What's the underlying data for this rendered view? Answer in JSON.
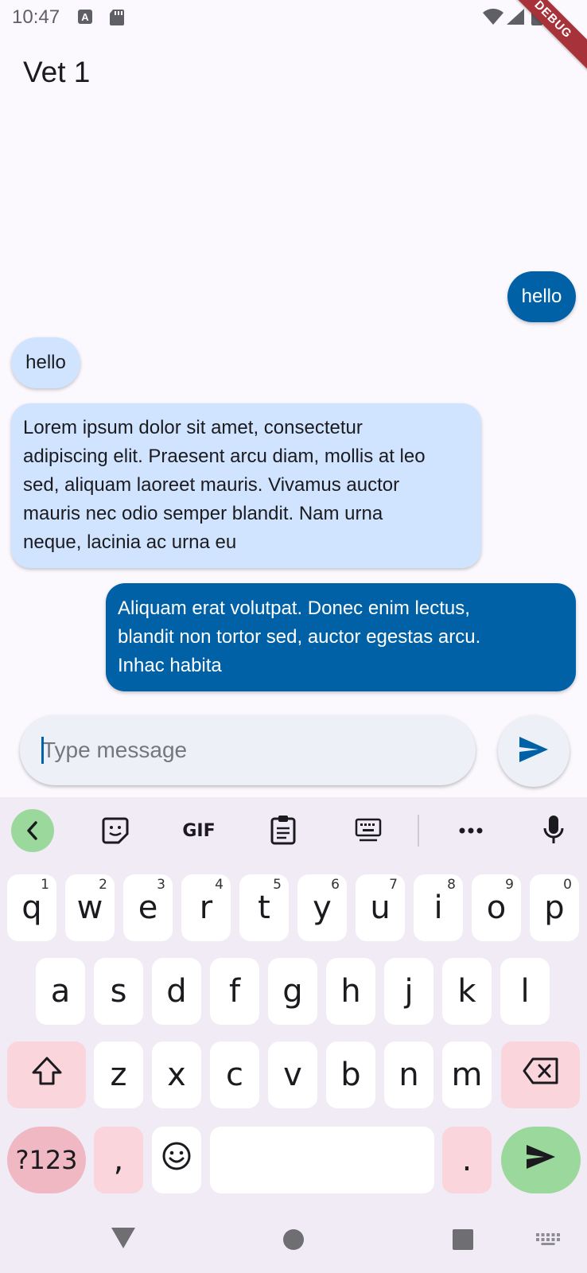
{
  "status_bar": {
    "time": "10:47",
    "debug_label": "DEBUG",
    "icons": [
      "a-notification-icon",
      "sd-card-icon",
      "wifi-icon",
      "signal-icon",
      "battery-icon"
    ]
  },
  "app_bar": {
    "title": "Vet 1"
  },
  "messages": [
    {
      "side": "sent",
      "text": "hello"
    },
    {
      "side": "received",
      "text": "hello"
    },
    {
      "side": "received",
      "text_lines": [
        "Lorem ipsum dolor sit amet, consectetur",
        "adipiscing elit. Praesent arcu diam, mollis at leo",
        "sed, aliquam laoreet mauris. Vivamus auctor",
        "mauris nec odio semper blandit. Nam urna",
        "neque, lacinia ac urna eu"
      ]
    },
    {
      "side": "sent",
      "text_lines": [
        "Aliquam erat volutpat. Donec enim lectus,",
        "blandit non tortor sed, auctor egestas arcu.",
        "Inhac habita"
      ]
    }
  ],
  "composer": {
    "placeholder": "Type message",
    "value": "",
    "send_icon": "send-icon"
  },
  "keyboard": {
    "toolbar": [
      "back-chevron-icon",
      "sticker-icon",
      "GIF",
      "clipboard-icon",
      "keyboard-layout-icon",
      "more-icon",
      "microphone-icon"
    ],
    "row1": [
      {
        "key": "q",
        "hint": "1"
      },
      {
        "key": "w",
        "hint": "2"
      },
      {
        "key": "e",
        "hint": "3"
      },
      {
        "key": "r",
        "hint": "4"
      },
      {
        "key": "t",
        "hint": "5"
      },
      {
        "key": "y",
        "hint": "6"
      },
      {
        "key": "u",
        "hint": "7"
      },
      {
        "key": "i",
        "hint": "8"
      },
      {
        "key": "o",
        "hint": "9"
      },
      {
        "key": "p",
        "hint": "0"
      }
    ],
    "row2": [
      "a",
      "s",
      "d",
      "f",
      "g",
      "h",
      "j",
      "k",
      "l"
    ],
    "row3": [
      "z",
      "x",
      "c",
      "v",
      "b",
      "n",
      "m"
    ],
    "symbols_label": "?123",
    "comma": ",",
    "period": "."
  },
  "colors": {
    "sent_bubble": "#0061a6",
    "received_bubble": "#d1e4ff",
    "keyboard_bg": "#f0ebf5",
    "accent_green": "#9ad89b",
    "accent_pink": "#fad6dc"
  }
}
